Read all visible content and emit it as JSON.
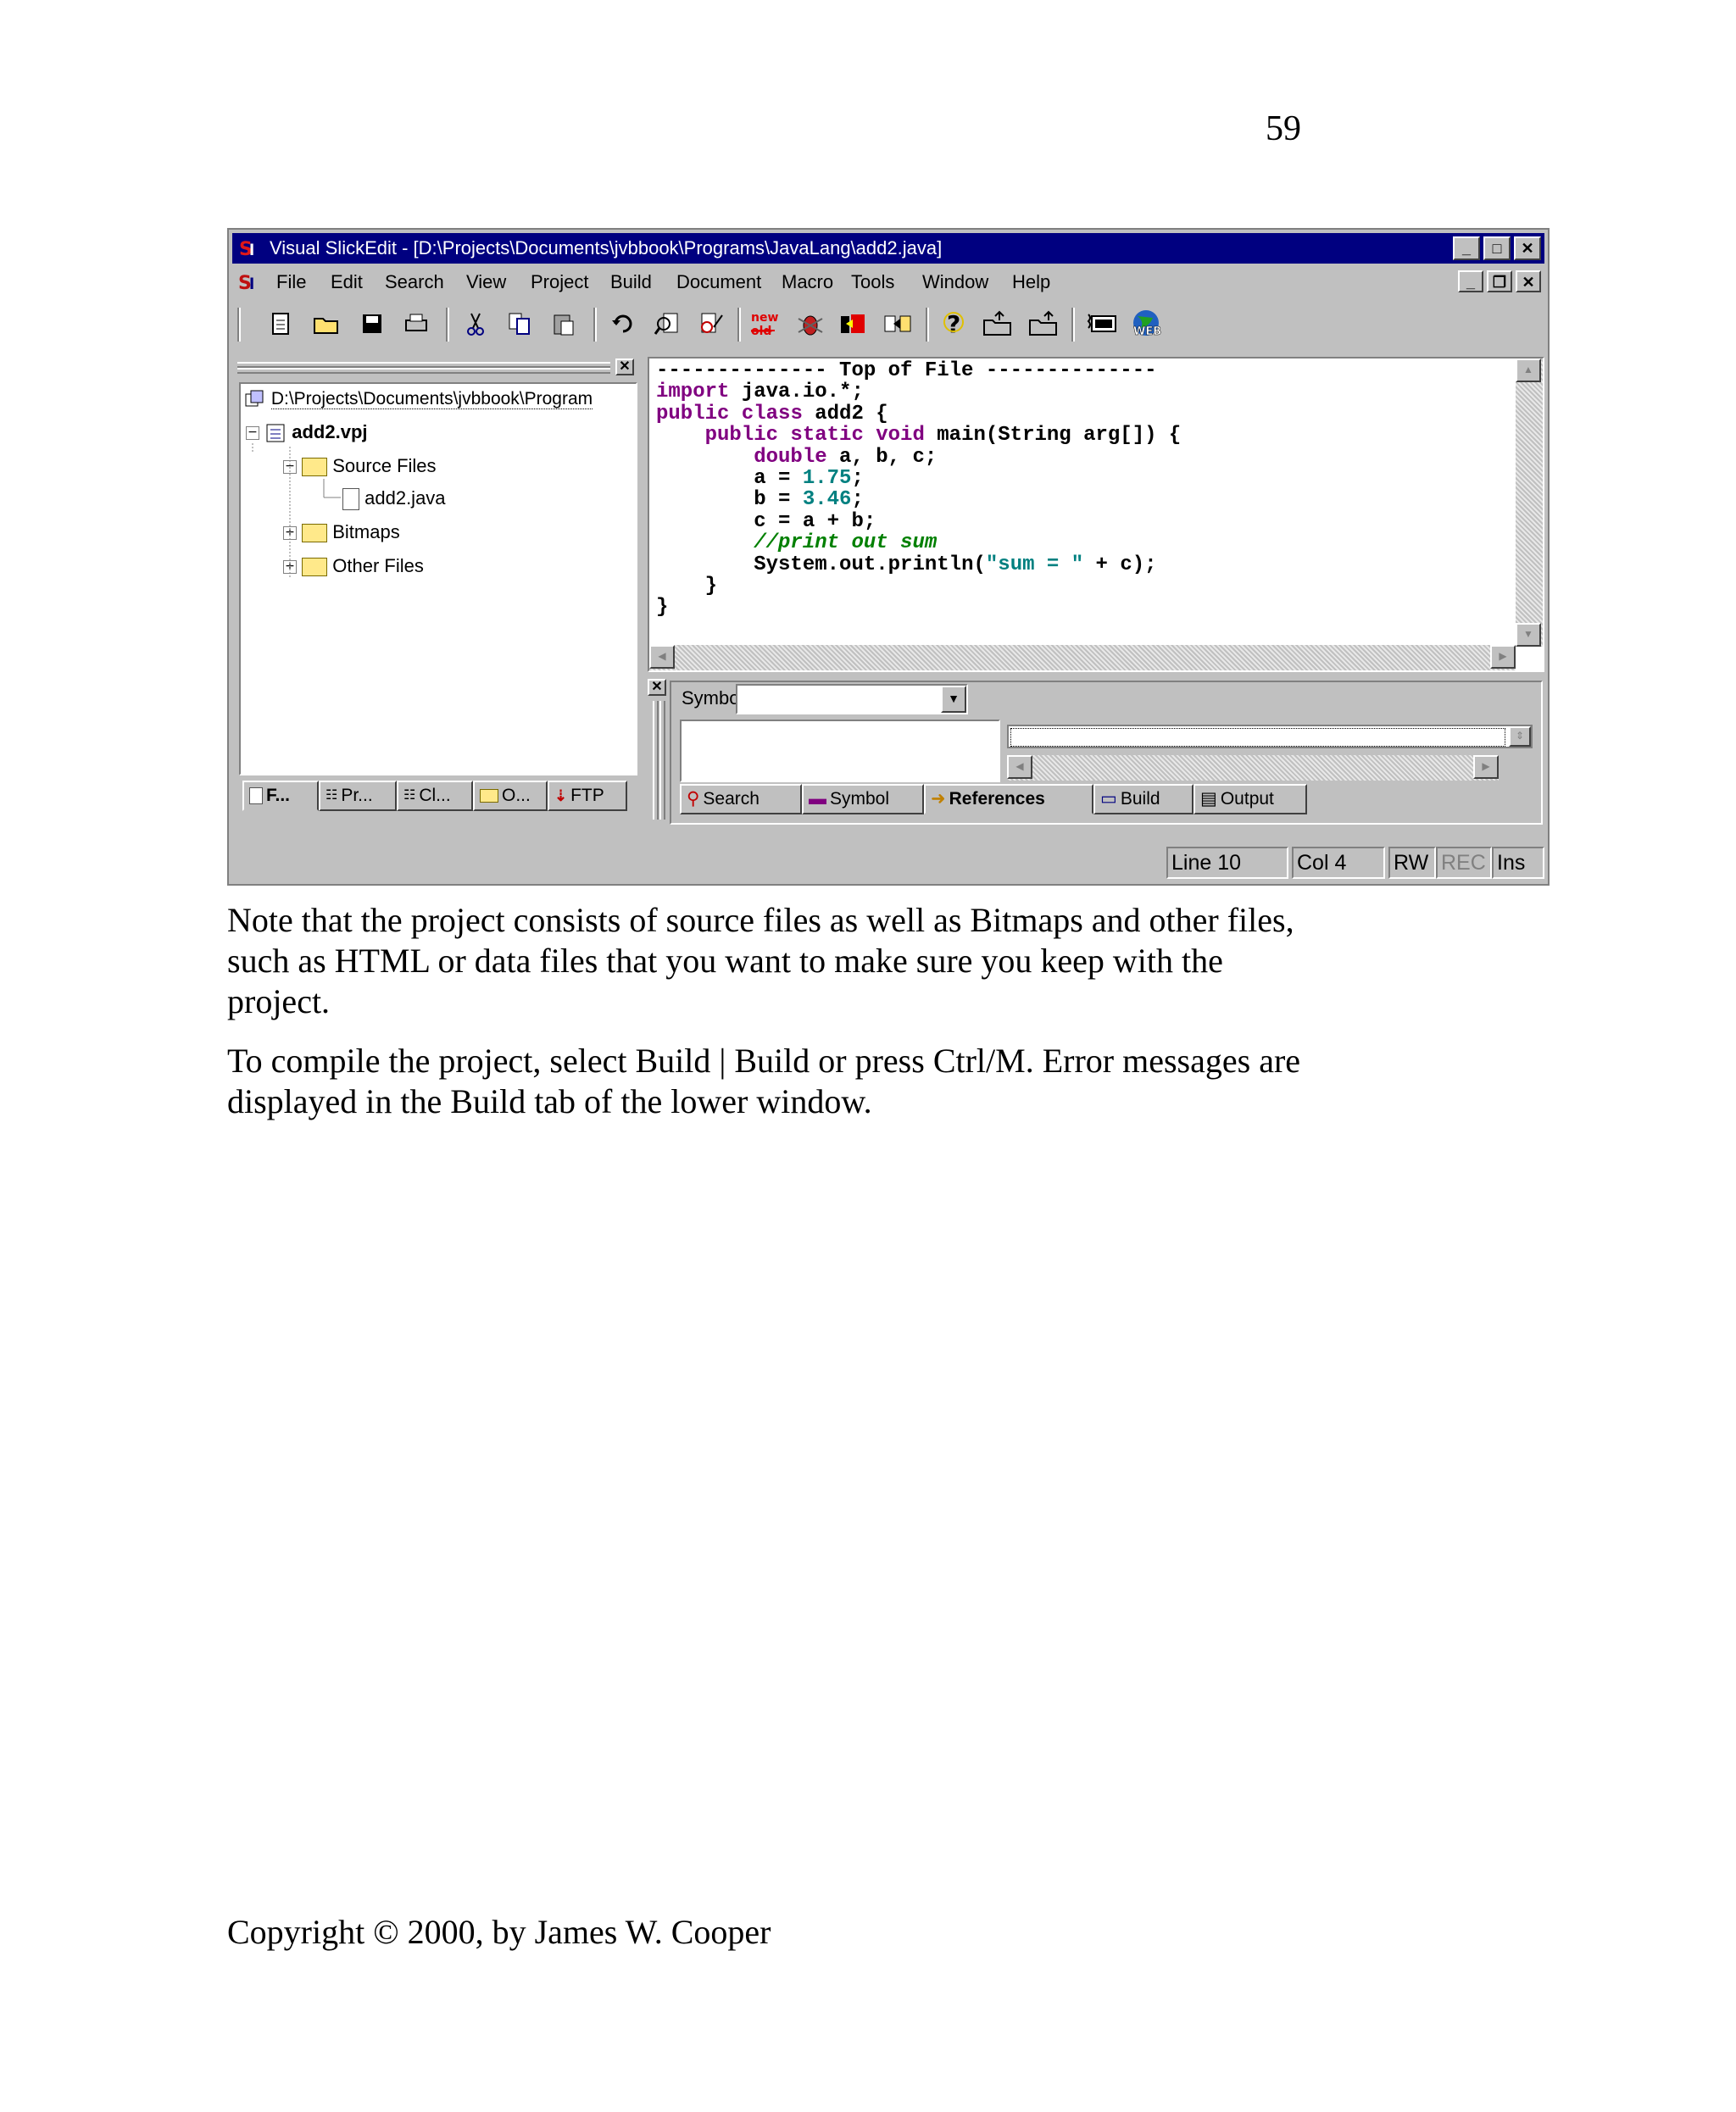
{
  "page_number": "59",
  "window": {
    "title": "Visual SlickEdit - [D:\\Projects\\Documents\\jvbbook\\Programs\\JavaLang\\add2.java]",
    "menu": [
      "File",
      "Edit",
      "Search",
      "View",
      "Project",
      "Build",
      "Document",
      "Macro",
      "Tools",
      "Window",
      "Help"
    ]
  },
  "project_tree": {
    "path": "D:\\Projects\\Documents\\jvbbook\\Program",
    "project": "add2.vpj",
    "source_files": "Source Files",
    "file": "add2.java",
    "bitmaps": "Bitmaps",
    "other_files": "Other Files"
  },
  "left_tabs": [
    "F...",
    "Pr...",
    "Cl...",
    "O...",
    "FTP"
  ],
  "code": {
    "line1": "-------------- Top of File --------------",
    "import_kw": "import",
    "import_rest": " java.io.*;",
    "public_kw": "public",
    "class_kw": "class",
    "class_name": " add2 {",
    "main_mods": "public static void",
    "main_sig": " main(String arg[]) {",
    "double_kw": "double",
    "double_vars": " a, b, c;",
    "a_assign": "a = ",
    "a_val": "1.75",
    "b_assign": "b = ",
    "b_val": "3.46",
    "c_assign": "c = a + b;",
    "comment": "//print out sum",
    "print_pre": "System.out.",
    "print_fn": "println",
    "print_str": "\"sum = \"",
    "print_post": " + c);",
    "close_inner": "}",
    "close_outer": "}"
  },
  "lower_panel": {
    "symbol_label": "Symbol:",
    "tabs": [
      "Search",
      "Symbol",
      "References",
      "Build",
      "Output"
    ]
  },
  "status": {
    "line": "Line 10",
    "col": "Col 4",
    "rw": "RW",
    "rec": "REC",
    "ins": "Ins"
  },
  "text": {
    "para1": "Note that the project consists of source files as well as Bitmaps and other files, such as HTML or data files that you want to make sure you keep with the project.",
    "para2": "To compile the project, select Build | Build or press Ctrl/M. Error messages are displayed in the Build tab of the lower window.",
    "copyright": "Copyright © 2000, by James W. Cooper"
  }
}
